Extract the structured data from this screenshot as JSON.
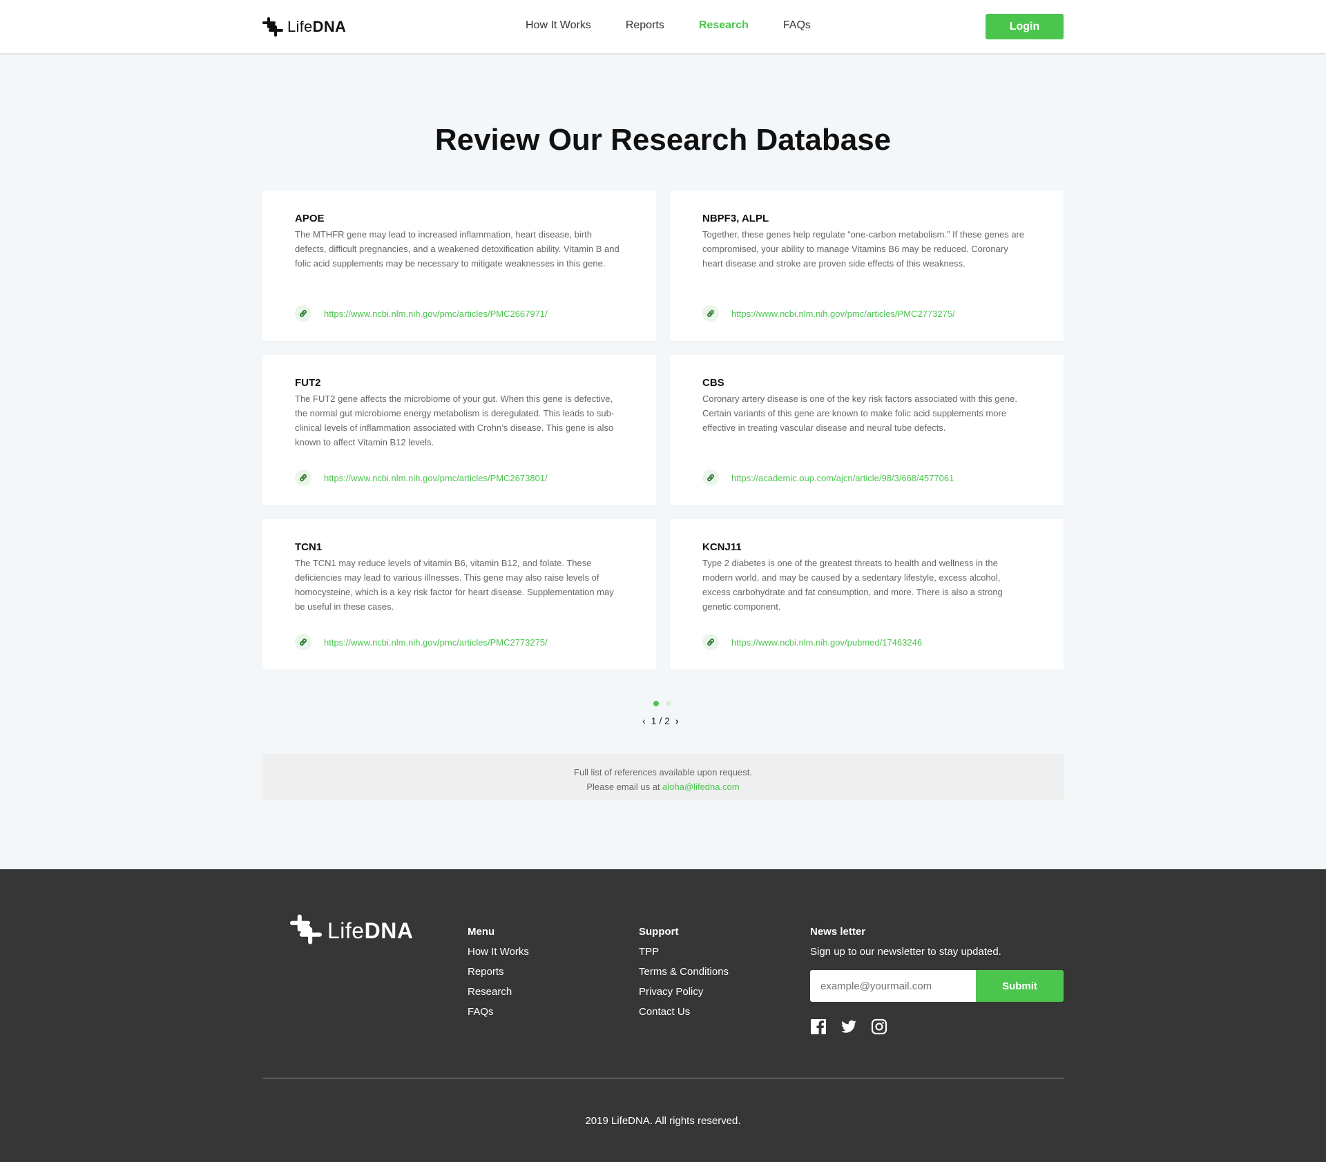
{
  "brand": {
    "logo_light": "Life",
    "logo_bold": "DNA",
    "accent_color": "#4cc54f"
  },
  "nav": {
    "items": [
      {
        "label": "How It Works",
        "active": false
      },
      {
        "label": "Reports",
        "active": false
      },
      {
        "label": "Research",
        "active": true
      },
      {
        "label": "FAQs",
        "active": false
      }
    ],
    "login_label": "Login"
  },
  "main": {
    "title": "Review Our Research Database",
    "cards": [
      {
        "title": "APOE",
        "description": "The MTHFR gene may lead to increased inflammation, heart disease, birth defects, difficult pregnancies, and a weakened detoxification ability. Vitamin B and folic acid supplements may be necessary to mitigate weaknesses in this gene.",
        "link": "https://www.ncbi.nlm.nih.gov/pmc/articles/PMC2667971/"
      },
      {
        "title": "NBPF3, ALPL",
        "description": "Together, these genes help regulate “one-carbon metabolism.” If these genes are compromised, your ability to manage Vitamins B6 may be reduced. Coronary heart disease and stroke are proven side effects of this weakness.",
        "link": "https://www.ncbi.nlm.nih.gov/pmc/articles/PMC2773275/"
      },
      {
        "title": "FUT2",
        "description": "The FUT2 gene affects the microbiome of your gut. When this gene is defective, the normal gut microbiome energy metabolism is deregulated. This leads to sub-clinical levels of inflammation associated with Crohn’s disease. This gene is also known to affect Vitamin B12 levels.",
        "link": "https://www.ncbi.nlm.nih.gov/pmc/articles/PMC2673801/"
      },
      {
        "title": "CBS",
        "description": "Coronary artery disease is one of the key risk factors associated with this gene. Certain variants of this gene are known to make folic acid supplements more effective in treating vascular disease and neural tube defects.",
        "link": "https://academic.oup.com/ajcn/article/98/3/668/4577061"
      },
      {
        "title": "TCN1",
        "description": "The TCN1 may reduce levels of vitamin B6, vitamin B12, and folate. These deficiencies may lead to various illnesses. This gene may also raise levels of homocysteine, which is a key risk factor for heart disease. Supplementation may be useful in these cases.",
        "link": "https://www.ncbi.nlm.nih.gov/pmc/articles/PMC2773275/"
      },
      {
        "title": "KCNJ11",
        "description": "Type 2 diabetes is one of the greatest threats to health and wellness in the modern world, and may be caused by a sedentary lifestyle, excess alcohol, excess carbohydrate and fat consumption, and more. There is also a strong genetic component.",
        "link": "https://www.ncbi.nlm.nih.gov/pubmed/17463246"
      }
    ],
    "pagination": {
      "label": "1 / 2",
      "prev": "‹",
      "next": "›"
    },
    "references": {
      "line1": "Full list of references available upon request.",
      "line2": "Please email us at ",
      "email": "aloha@lifedna.com"
    }
  },
  "footer": {
    "logo_light": "Life",
    "logo_bold": "DNA",
    "menu": {
      "heading": "Menu",
      "items": [
        "How It Works",
        "Reports",
        "Research",
        "FAQs"
      ]
    },
    "support": {
      "heading": "Support",
      "items": [
        "TPP",
        "Terms & Conditions",
        "Privacy Policy",
        "Contact Us"
      ]
    },
    "newsletter": {
      "heading": "News letter",
      "text": "Sign up to our newsletter to stay updated.",
      "placeholder": "example@yourmail.com",
      "submit_label": "Submit"
    },
    "socials": [
      "facebook-icon",
      "twitter-icon",
      "instagram-icon"
    ],
    "copyright": "2019 LifeDNA. All rights reserved."
  }
}
